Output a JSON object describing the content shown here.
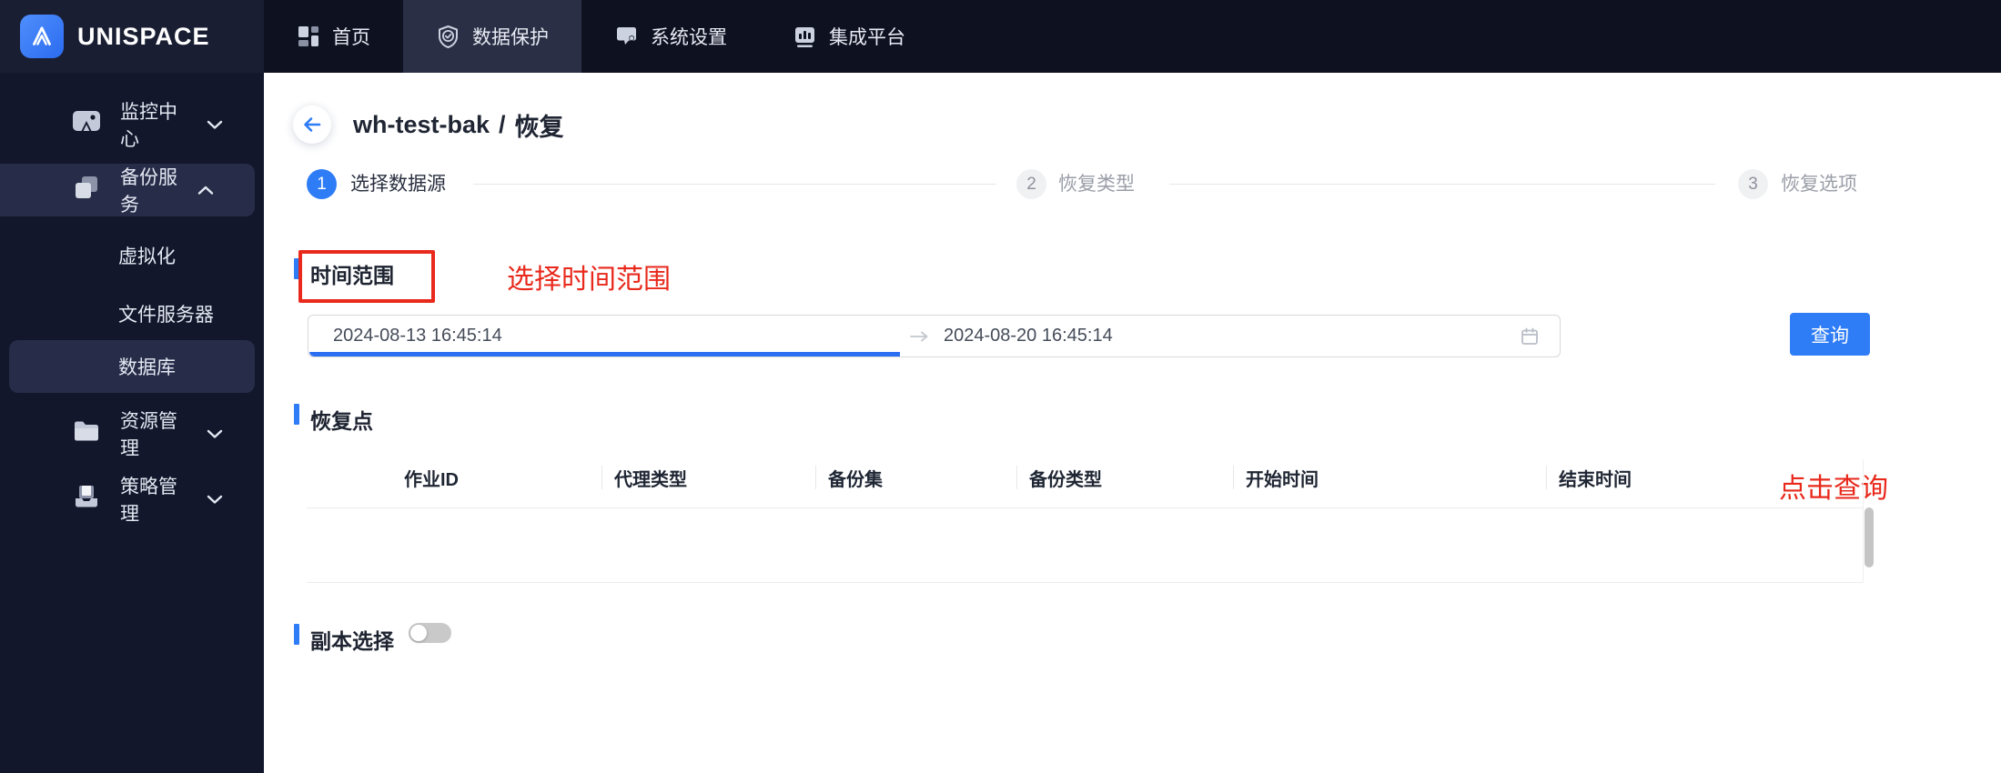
{
  "brand": {
    "name": "UNISPACE"
  },
  "topnav": {
    "items": [
      {
        "label": "首页",
        "icon": "dashboard-icon",
        "active": false
      },
      {
        "label": "数据保护",
        "icon": "shield-check-icon",
        "active": true
      },
      {
        "label": "系统设置",
        "icon": "system-settings-icon",
        "active": false
      },
      {
        "label": "集成平台",
        "icon": "integration-platform-icon",
        "active": false
      }
    ]
  },
  "sidebar": {
    "items": [
      {
        "label": "监控中心",
        "icon": "monitor-icon",
        "state": "collapsed"
      },
      {
        "label": "备份服务",
        "icon": "backup-copy-icon",
        "state": "expanded",
        "active": true,
        "children": [
          {
            "label": "虚拟化",
            "active": false
          },
          {
            "label": "文件服务器",
            "active": false
          },
          {
            "label": "数据库",
            "active": true
          }
        ]
      },
      {
        "label": "资源管理",
        "icon": "folder-icon",
        "state": "collapsed"
      },
      {
        "label": "策略管理",
        "icon": "policy-icon",
        "state": "collapsed"
      }
    ]
  },
  "main": {
    "breadcrumb": {
      "name": "wh-test-bak",
      "separator": "/",
      "action": "恢复"
    },
    "steps": [
      {
        "number": "1",
        "label": "选择数据源",
        "active": true
      },
      {
        "number": "2",
        "label": "恢复类型",
        "active": false
      },
      {
        "number": "3",
        "label": "恢复选项",
        "active": false
      }
    ],
    "time_range": {
      "title": "时间范围",
      "start_value": "2024-08-13 16:45:14",
      "end_value": "2024-08-20 16:45:14",
      "query_button": "查询"
    },
    "annotations": {
      "select_time_range": "选择时间范围",
      "click_query": "点击查询",
      "color": "#e8291c"
    },
    "restore_points": {
      "title": "恢复点",
      "columns": [
        "作业ID",
        "代理类型",
        "备份集",
        "备份类型",
        "开始时间",
        "结束时间"
      ],
      "rows": []
    },
    "replica": {
      "title": "副本选择",
      "toggle_state": "off"
    }
  },
  "colors": {
    "accent_blue": "#2e7cf6",
    "annotation_red": "#e8291c",
    "topbar_bg": "#0d1120",
    "brand_panel_bg": "#191e33",
    "sidebar_bg": "#12172c",
    "active_item_bg": "#272d49"
  }
}
